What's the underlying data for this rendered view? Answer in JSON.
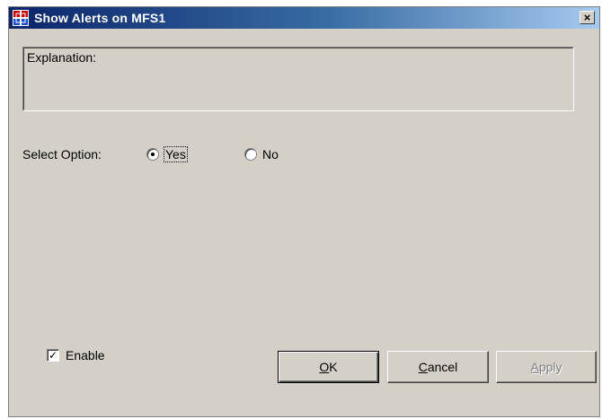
{
  "window": {
    "title": "Show Alerts on MFS1",
    "close_glyph": "×",
    "app_icon": "grid-app-icon"
  },
  "explanation": {
    "label": "Explanation:"
  },
  "select_option": {
    "label": "Select Option:",
    "options": [
      {
        "label": "Yes",
        "selected": true
      },
      {
        "label": "No",
        "selected": false
      }
    ]
  },
  "enable": {
    "label": "Enable",
    "checked": true,
    "check_glyph": "✓"
  },
  "buttons": {
    "ok": {
      "accel": "O",
      "rest": "K"
    },
    "cancel": {
      "accel": "C",
      "rest": "ancel"
    },
    "apply": {
      "accel": "A",
      "rest": "pply",
      "disabled": true
    }
  },
  "colors": {
    "titlebar_start": "#0a246a",
    "titlebar_end": "#a6caf0",
    "face": "#d4d0c8"
  }
}
